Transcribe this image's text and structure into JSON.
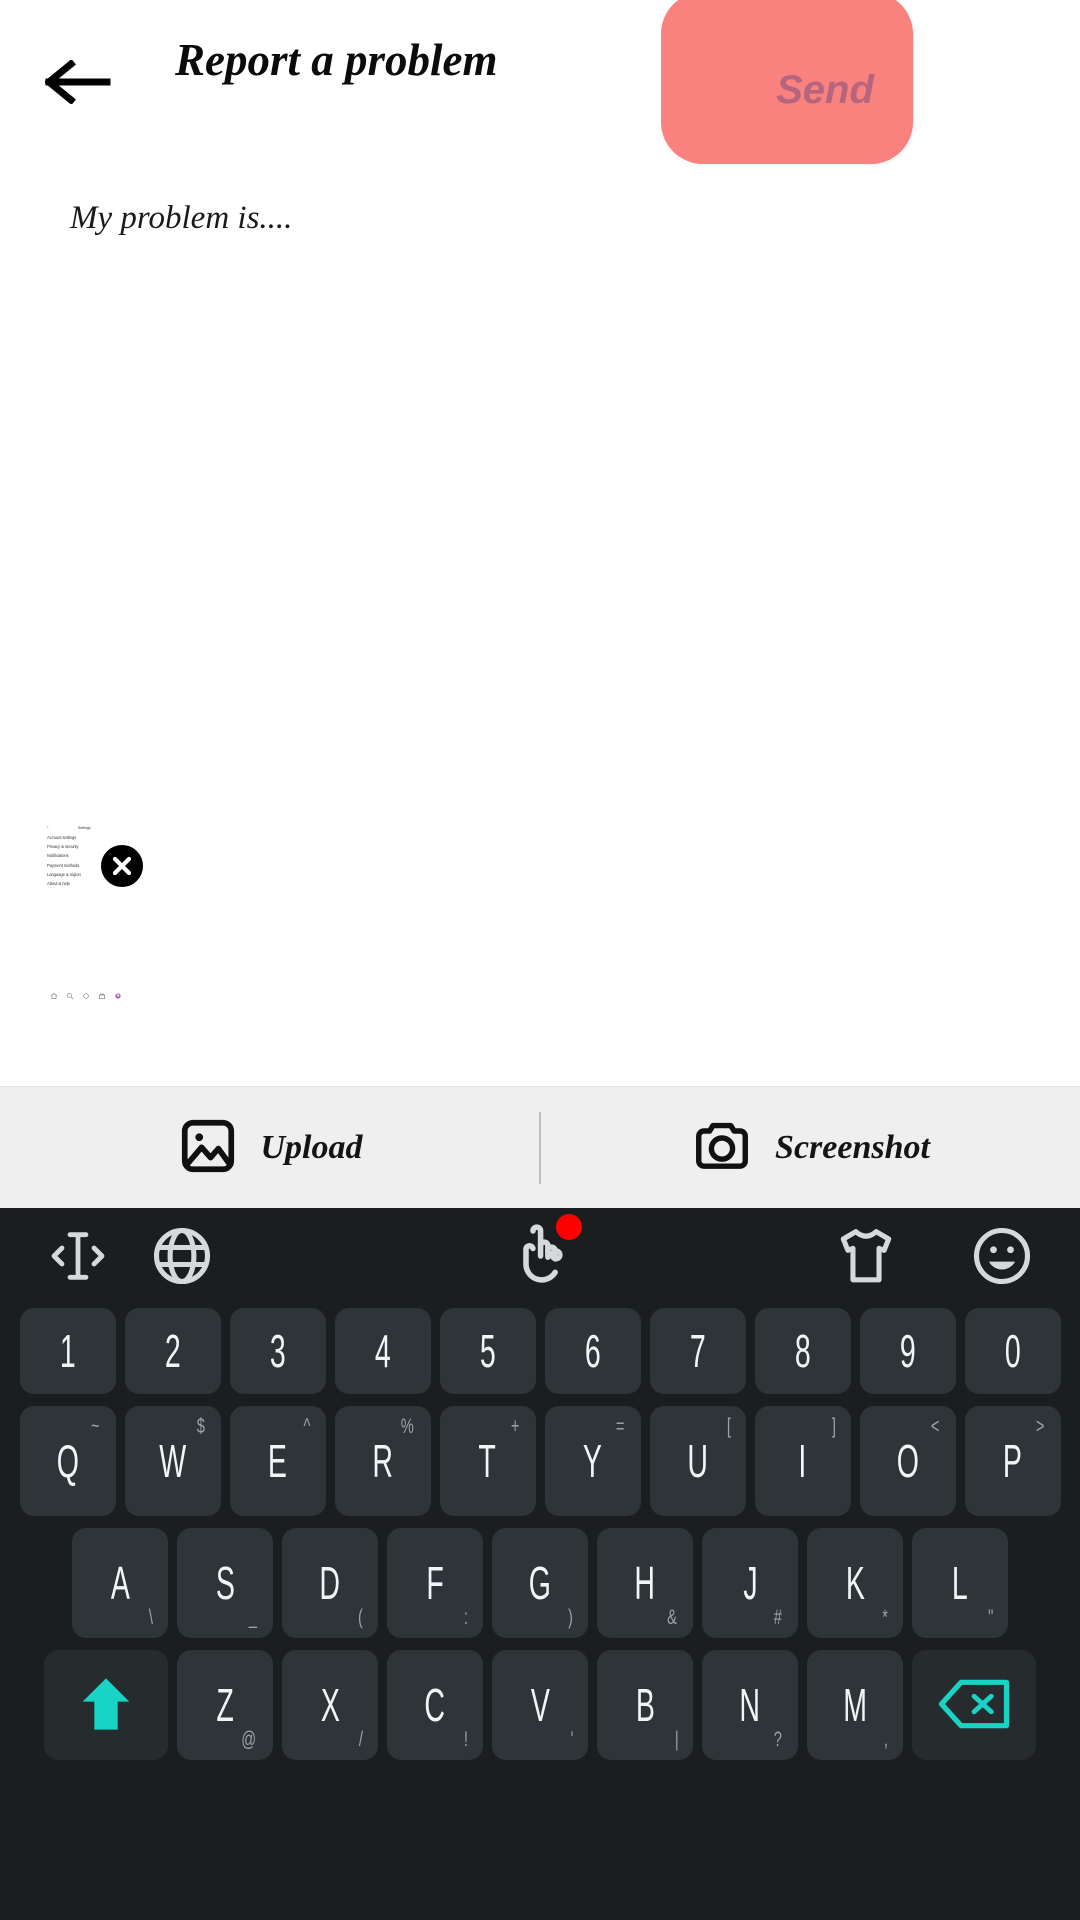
{
  "header": {
    "back_icon": "arrow-left-icon",
    "title": "Report a problem",
    "send_label": "Send",
    "send_bg": "#f9817e",
    "send_text_color": "#b5657d"
  },
  "compose": {
    "placeholder": "My problem is...."
  },
  "attachment": {
    "close_icon": "close-circle-icon",
    "thumbnail": {
      "type": "screenshot-preview",
      "back_chevron": "‹",
      "header_title": "Settings",
      "subtitle_lines": [
        "Account settings",
        "Privacy & security"
      ],
      "rows": [
        {
          "label": "Notifications",
          "arrow": "›"
        },
        {
          "label": "Payment methods",
          "arrow": "›"
        },
        {
          "label": "Language & region",
          "arrow": "›"
        },
        {
          "label": "About & help",
          "arrow": "›"
        }
      ],
      "tabbar_icons": [
        "home-icon",
        "search-icon",
        "circle-icon",
        "shop-icon",
        "avatar-icon"
      ]
    }
  },
  "attach_bar": {
    "upload_label": "Upload",
    "upload_icon": "image-icon",
    "screenshot_label": "Screenshot",
    "screenshot_icon": "camera-icon"
  },
  "keyboard": {
    "toolbar": {
      "cursor_icon": "cursor-move-icon",
      "globe_icon": "globe-icon",
      "gesture_icon": "hand-gesture-icon",
      "gesture_badge_color": "#ff0000",
      "theme_icon": "tshirt-icon",
      "emoji_icon": "smiley-icon"
    },
    "accent_color": "#19d3c5",
    "key_bg": "#2e3538",
    "background": "#1b1e1f",
    "rows": {
      "numbers": [
        "1",
        "2",
        "3",
        "4",
        "5",
        "6",
        "7",
        "8",
        "9",
        "0"
      ],
      "top": [
        {
          "main": "Q",
          "sup": "~"
        },
        {
          "main": "W",
          "sup": "$"
        },
        {
          "main": "E",
          "sup": "^"
        },
        {
          "main": "R",
          "sup": "%"
        },
        {
          "main": "T",
          "sup": "+"
        },
        {
          "main": "Y",
          "sup": "="
        },
        {
          "main": "U",
          "sup": "["
        },
        {
          "main": "I",
          "sup": "]"
        },
        {
          "main": "O",
          "sup": "<"
        },
        {
          "main": "P",
          "sup": ">"
        }
      ],
      "home": [
        {
          "main": "A",
          "sub": "\\"
        },
        {
          "main": "S",
          "sub": "_"
        },
        {
          "main": "D",
          "sub": "("
        },
        {
          "main": "F",
          "sub": ":"
        },
        {
          "main": "G",
          "sub": ")"
        },
        {
          "main": "H",
          "sub": "&"
        },
        {
          "main": "J",
          "sub": "#"
        },
        {
          "main": "K",
          "sub": "*"
        },
        {
          "main": "L",
          "sub": "\""
        }
      ],
      "bottom": [
        {
          "main": "Z",
          "sub": "@"
        },
        {
          "main": "X",
          "sub": "/"
        },
        {
          "main": "C",
          "sub": "!"
        },
        {
          "main": "V",
          "sub": "'"
        },
        {
          "main": "B",
          "sub": "|"
        },
        {
          "main": "N",
          "sub": "?"
        },
        {
          "main": "M",
          "sub": ","
        }
      ],
      "shift_icon": "shift-arrow-icon",
      "backspace_icon": "backspace-icon"
    }
  }
}
